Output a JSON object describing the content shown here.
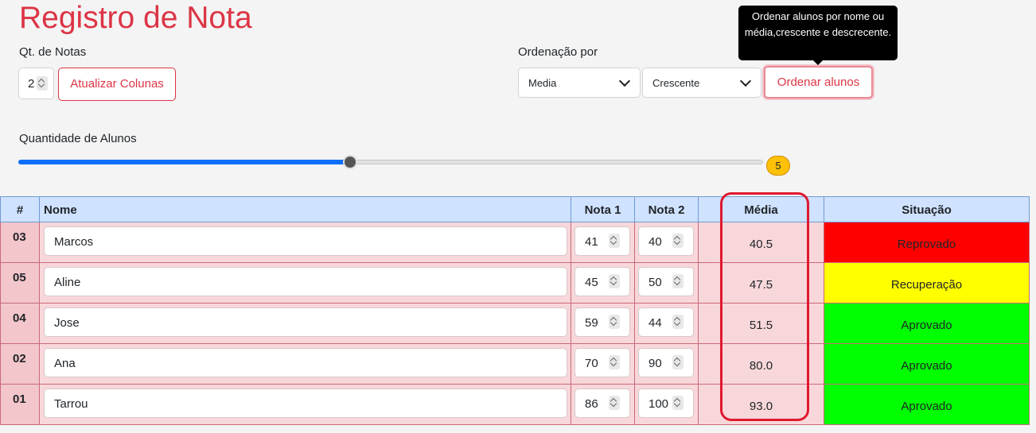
{
  "page": {
    "title": "Registro de Nota"
  },
  "notes_qty": {
    "label": "Qt. de Notas",
    "value": "2",
    "update_button": "Atualizar Colunas"
  },
  "ordering": {
    "label": "Ordenação por",
    "field_select": "Media",
    "direction_select": "Crescente",
    "sort_button": "Ordenar alunos",
    "tooltip": "Ordenar alunos por nome ou média,crescente e descrecente."
  },
  "students_qty": {
    "label": "Quantidade de Alunos",
    "value": "5",
    "slider_fraction": 0.445
  },
  "table": {
    "headers": {
      "index": "#",
      "name": "Nome",
      "nota1": "Nota 1",
      "nota2": "Nota 2",
      "media": "Média",
      "situacao": "Situação"
    },
    "rows": [
      {
        "index": "03",
        "name": "Marcos",
        "nota1": "41",
        "nota2": "40",
        "media": "40.5",
        "situacao": "Reprovado",
        "status_color": "#ff0000"
      },
      {
        "index": "05",
        "name": "Aline",
        "nota1": "45",
        "nota2": "50",
        "media": "47.5",
        "situacao": "Recuperação",
        "status_color": "#ffff00"
      },
      {
        "index": "04",
        "name": "Jose",
        "nota1": "59",
        "nota2": "44",
        "media": "51.5",
        "situacao": "Aprovado",
        "status_color": "#00ff00"
      },
      {
        "index": "02",
        "name": "Ana",
        "nota1": "70",
        "nota2": "90",
        "media": "80.0",
        "situacao": "Aprovado",
        "status_color": "#00ff00"
      },
      {
        "index": "01",
        "name": "Tarrou",
        "nota1": "86",
        "nota2": "100",
        "media": "93.0",
        "situacao": "Aprovado",
        "status_color": "#00ff00"
      }
    ]
  },
  "colors": {
    "accent": "#dc3545",
    "header_bg": "#cfe2ff",
    "row_bg": "#f8d7da",
    "slider_fill": "#0d6efd",
    "badge": "#ffc107"
  }
}
